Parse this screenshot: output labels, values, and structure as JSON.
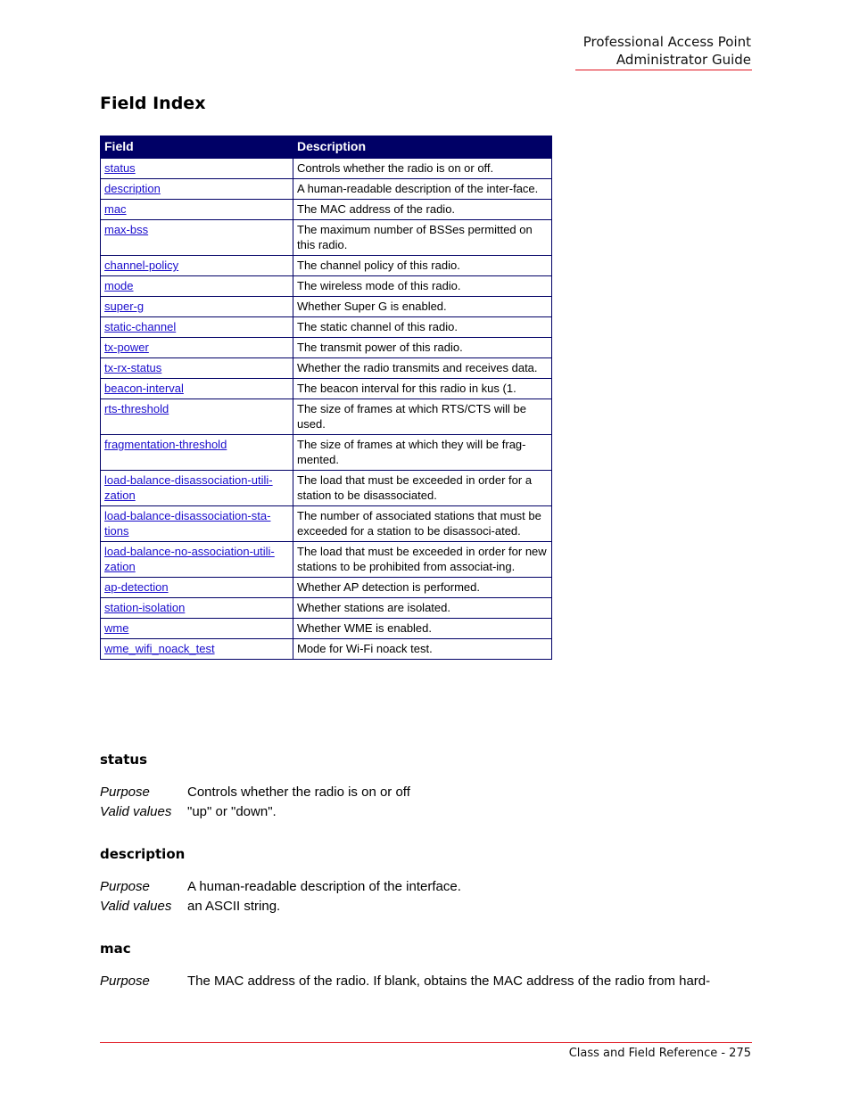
{
  "header": {
    "line1": "Professional Access Point",
    "line2": "Administrator Guide"
  },
  "title": "Field Index",
  "table": {
    "headers": [
      "Field",
      "Description"
    ],
    "rows": [
      {
        "field": "status",
        "description": "Controls whether the radio is on or off."
      },
      {
        "field": "description",
        "description": "A human-readable description of the inter-face."
      },
      {
        "field": "mac",
        "description": "The MAC address of the radio."
      },
      {
        "field": "max-bss",
        "description": "The maximum number of BSSes permitted on this radio."
      },
      {
        "field": "channel-policy",
        "description": "The channel policy of this radio."
      },
      {
        "field": "mode",
        "description": "The wireless mode of this radio."
      },
      {
        "field": "super-g",
        "description": "Whether Super G is enabled."
      },
      {
        "field": "static-channel",
        "description": "The static channel of this radio."
      },
      {
        "field": "tx-power",
        "description": "The transmit power of this radio."
      },
      {
        "field": "tx-rx-status",
        "description": "Whether the radio transmits and receives data."
      },
      {
        "field": "beacon-interval",
        "description": "The beacon interval for this radio in kus (1."
      },
      {
        "field": "rts-threshold",
        "description": "The size of frames at which RTS/CTS will be used."
      },
      {
        "field": "fragmentation-threshold",
        "description": "The size of frames at which they will be frag-mented."
      },
      {
        "field": "load-balance-disassociation-utili-zation",
        "description": "The load that must be exceeded in order for a station to be disassociated."
      },
      {
        "field": "load-balance-disassociation-sta-tions",
        "description": "The number of associated stations that must be exceeded for a station to be disassoci-ated."
      },
      {
        "field": "load-balance-no-association-utili-zation",
        "description": "The load that must be exceeded in order for new stations to be prohibited from associat-ing."
      },
      {
        "field": "ap-detection",
        "description": "Whether AP detection is performed."
      },
      {
        "field": "station-isolation",
        "description": "Whether stations are isolated."
      },
      {
        "field": "wme",
        "description": "Whether WME is enabled."
      },
      {
        "field": "wme_wifi_noack_test",
        "description": "Mode for Wi-Fi noack test."
      }
    ]
  },
  "sections": [
    {
      "heading": "status",
      "purpose_label": "Purpose",
      "purpose": "Controls whether the radio is on or off",
      "valid_label": "Valid values",
      "valid": "\"up\" or \"down\"."
    },
    {
      "heading": "description",
      "purpose_label": "Purpose",
      "purpose": "A human-readable description of the interface.",
      "valid_label": "Valid values",
      "valid": "an ASCII string."
    },
    {
      "heading": "mac",
      "purpose_label": "Purpose",
      "purpose": "The MAC address of the radio. If blank, obtains the MAC address of the radio from hard-"
    }
  ],
  "footer": "Class and Field Reference - 275",
  "colors": {
    "table_header_bg": "#000066",
    "link": "#1a0dcc",
    "rule": "#e0141e"
  }
}
